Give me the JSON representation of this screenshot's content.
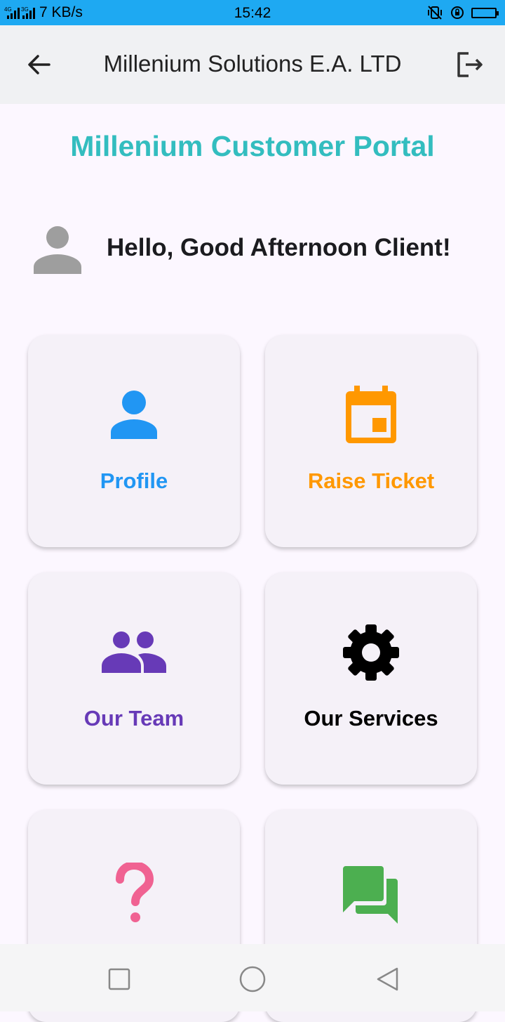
{
  "status_bar": {
    "network": "4G",
    "network2": "3G",
    "speed": "7 KB/s",
    "time": "15:42"
  },
  "app_bar": {
    "title": "Millenium Solutions E.A. LTD",
    "back_icon": "arrow-back-icon",
    "logout_icon": "logout-icon"
  },
  "portal_title": "Millenium Customer Portal",
  "greeting": "Hello, Good Afternoon Client!",
  "cards": [
    {
      "label": "Profile",
      "icon": "person-icon",
      "color": "#2196f3"
    },
    {
      "label": "Raise Ticket",
      "icon": "calendar-icon",
      "color": "#ff9800"
    },
    {
      "label": "Our Team",
      "icon": "group-icon",
      "color": "#673ab7"
    },
    {
      "label": "Our Services",
      "icon": "gear-icon",
      "color": "#000000"
    },
    {
      "label": "",
      "icon": "question-mark-icon",
      "color": "#f06292"
    },
    {
      "label": "",
      "icon": "forum-icon",
      "color": "#4caf50"
    }
  ],
  "colors": {
    "status_bar": "#1ea9f2",
    "app_bar": "#f0f1f3",
    "background": "#fcf7ff",
    "portal_title": "#33bdbf"
  }
}
